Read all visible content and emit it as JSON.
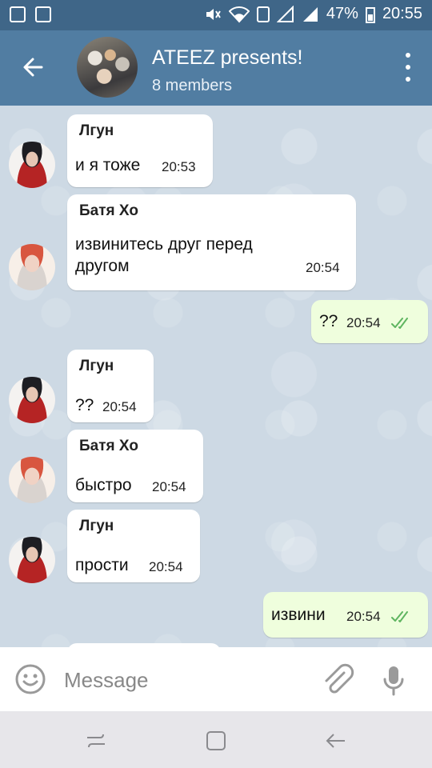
{
  "status_bar": {
    "battery": "47%",
    "time": "20:55"
  },
  "header": {
    "title": "ATEEZ presents!",
    "subtitle": "8 members"
  },
  "messages": [
    {
      "author": "Лгун",
      "text": "и я тоже",
      "time": "20:53",
      "incoming": true,
      "avatar": "lgun"
    },
    {
      "author": "Батя Хо",
      "text_lines": [
        "извинитесь друг перед",
        "другом"
      ],
      "time": "20:54",
      "incoming": true,
      "avatar": "batya"
    },
    {
      "text": "??",
      "time": "20:54",
      "incoming": false,
      "status": "read"
    },
    {
      "author": "Лгун",
      "text": "??",
      "time": "20:54",
      "incoming": true,
      "avatar": "lgun"
    },
    {
      "author": "Батя Хо",
      "text": "быстро",
      "time": "20:54",
      "incoming": true,
      "avatar": "batya"
    },
    {
      "author": "Лгун",
      "text": "прости",
      "time": "20:54",
      "incoming": true,
      "avatar": "lgun"
    },
    {
      "text": "извини",
      "time": "20:54",
      "incoming": false,
      "status": "read"
    }
  ],
  "composer": {
    "placeholder": "Message"
  },
  "icons": {
    "back": "arrow-left-icon",
    "menu": "more-vertical-icon",
    "emoji": "emoji-icon",
    "attach": "paperclip-icon",
    "mic": "microphone-icon",
    "read_status": "double-check-icon"
  },
  "colors": {
    "header": "#517da2",
    "status_bar": "#3f6688",
    "chat_background": "#cdd9e4",
    "outgoing_bubble": "#effedd",
    "incoming_bubble": "#ffffff",
    "read_check": "#5fb560"
  }
}
